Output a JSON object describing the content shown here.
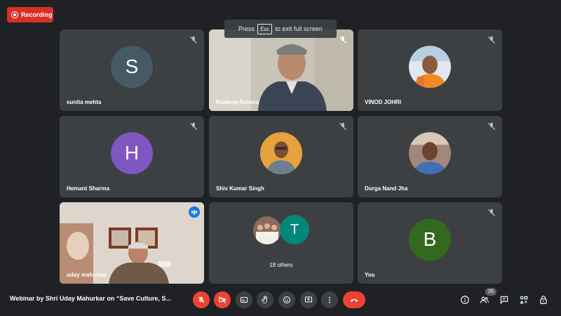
{
  "recording": {
    "label": "Recording"
  },
  "fullscreen_hint": {
    "prefix": "Press",
    "key": "Esc",
    "suffix": "to exit full screen"
  },
  "participants": [
    {
      "name": "sunita mehta",
      "avatar": "S",
      "avatar_color": "#455a64",
      "muted": true
    },
    {
      "name": "Kuldeep Ratnoo",
      "video": true,
      "muted": true
    },
    {
      "name": "VINOD JOHRI",
      "photo": true,
      "muted": true
    },
    {
      "name": "Hemant Sharma",
      "avatar": "H",
      "avatar_color": "#7e57c2",
      "muted": true
    },
    {
      "name": "Shiv Kumar Singh",
      "photo": true,
      "muted": true
    },
    {
      "name": "Durga Nand Jha",
      "photo": true,
      "muted": true
    },
    {
      "name": "uday mahurkar",
      "video": true,
      "speaking": true
    },
    {
      "others_label": "18 others",
      "others_avatar": "T",
      "others_avatar_color": "#00897b"
    },
    {
      "name": "You",
      "avatar": "B",
      "avatar_color": "#33691e",
      "muted": true
    }
  ],
  "meeting": {
    "title": "Webinar by Shri Uday Mahurkar on “Save Culture, S..."
  },
  "people_count": "26",
  "colors": {
    "background": "#202124",
    "tile": "#3c4043",
    "danger": "#ea4335",
    "accent": "#1a73e8"
  },
  "controls": [
    "mic-off-icon",
    "camera-off-icon",
    "captions-icon",
    "raise-hand-icon",
    "emoji-icon",
    "present-icon",
    "more-icon",
    "end-call-icon"
  ],
  "right_controls": [
    "info-icon",
    "people-icon",
    "chat-icon",
    "activities-icon",
    "host-controls-icon"
  ]
}
